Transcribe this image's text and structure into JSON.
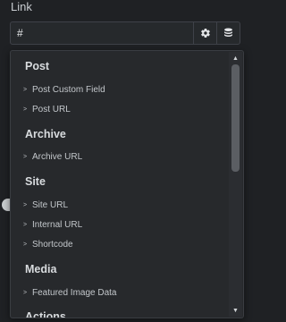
{
  "control": {
    "label": "Link",
    "value": "#",
    "settings_icon": "gear-icon",
    "dynamic_tags_icon": "database-icon"
  },
  "dropdown": {
    "groups": [
      {
        "title": "Post",
        "options": [
          "Post Custom Field",
          "Post URL"
        ]
      },
      {
        "title": "Archive",
        "options": [
          "Archive URL"
        ]
      },
      {
        "title": "Site",
        "options": [
          "Site URL",
          "Internal URL",
          "Shortcode"
        ]
      },
      {
        "title": "Media",
        "options": [
          "Featured Image Data"
        ]
      },
      {
        "title": "Actions",
        "options": []
      }
    ],
    "option_marker": ">"
  },
  "scrollbar": {
    "up_arrow": "▲",
    "down_arrow": "▼",
    "scroll_position": 0
  },
  "colors": {
    "panel_bg": "#1f2124",
    "dropdown_bg": "#27292c",
    "text": "#d5d8dc",
    "border": "#3f4249"
  }
}
